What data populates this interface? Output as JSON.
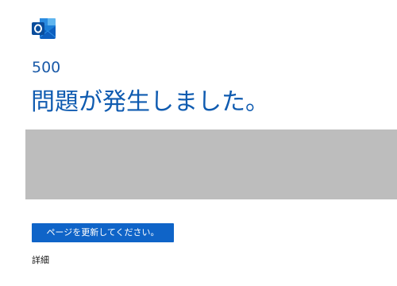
{
  "app": {
    "logo_icon": "outlook-logo-icon",
    "brand_color": "#0f64c8"
  },
  "error": {
    "code": "500",
    "title": "問題が発生しました。"
  },
  "actions": {
    "refresh_label": "ページを更新してください。",
    "details_label": "詳細"
  }
}
